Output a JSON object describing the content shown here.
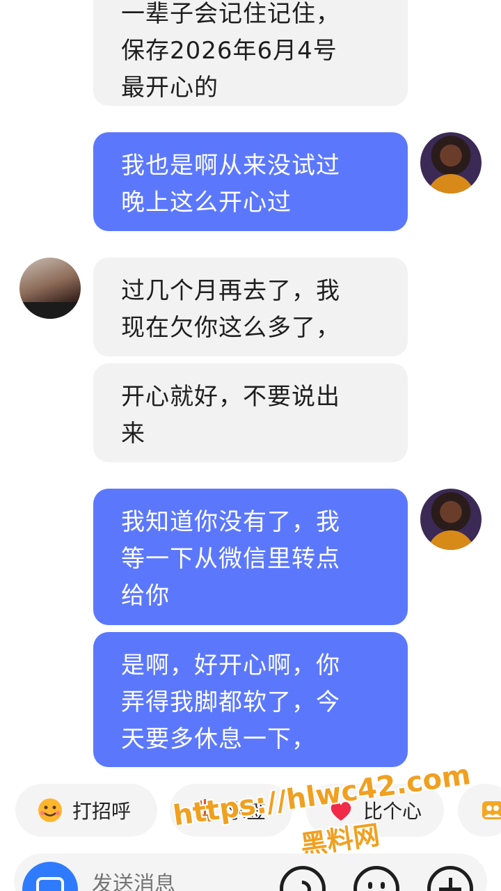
{
  "messages": [
    {
      "side": "in",
      "lines": [
        "一辈子会记住记住，",
        "保存2026年6月4号",
        "最开心的"
      ]
    },
    {
      "side": "out",
      "lines": [
        "我也是啊从来没试过",
        "晚上这么开心过"
      ]
    },
    {
      "side": "in",
      "lines": [
        "过几个月再去了，我",
        "现在欠你这么多了，"
      ]
    },
    {
      "side": "in",
      "lines": [
        "开心就好，不要说出",
        "来"
      ]
    },
    {
      "side": "out",
      "lines": [
        "我知道你没有了，我",
        "等一下从微信里转点",
        "给你"
      ]
    },
    {
      "side": "out",
      "lines": [
        "是啊，好开心啊，你",
        "弄得我脚都软了，今",
        "天要多休息一下，"
      ]
    }
  ],
  "quick_replies": [
    {
      "label": "打招呼",
      "icon": "smile-wave-icon"
    },
    {
      "label": "求签",
      "icon": "incense-icon"
    },
    {
      "label": "比个心",
      "icon": "heart-icon"
    },
    {
      "label": "",
      "icon": "group-icon"
    }
  ],
  "input": {
    "placeholder": "发送消息"
  },
  "watermark": {
    "url": "https://hlwc42.com",
    "site": "黑料网"
  },
  "colors": {
    "outgoing": "#5b78fd",
    "incoming": "#f2f2f2",
    "watermark": "#f0a020"
  }
}
